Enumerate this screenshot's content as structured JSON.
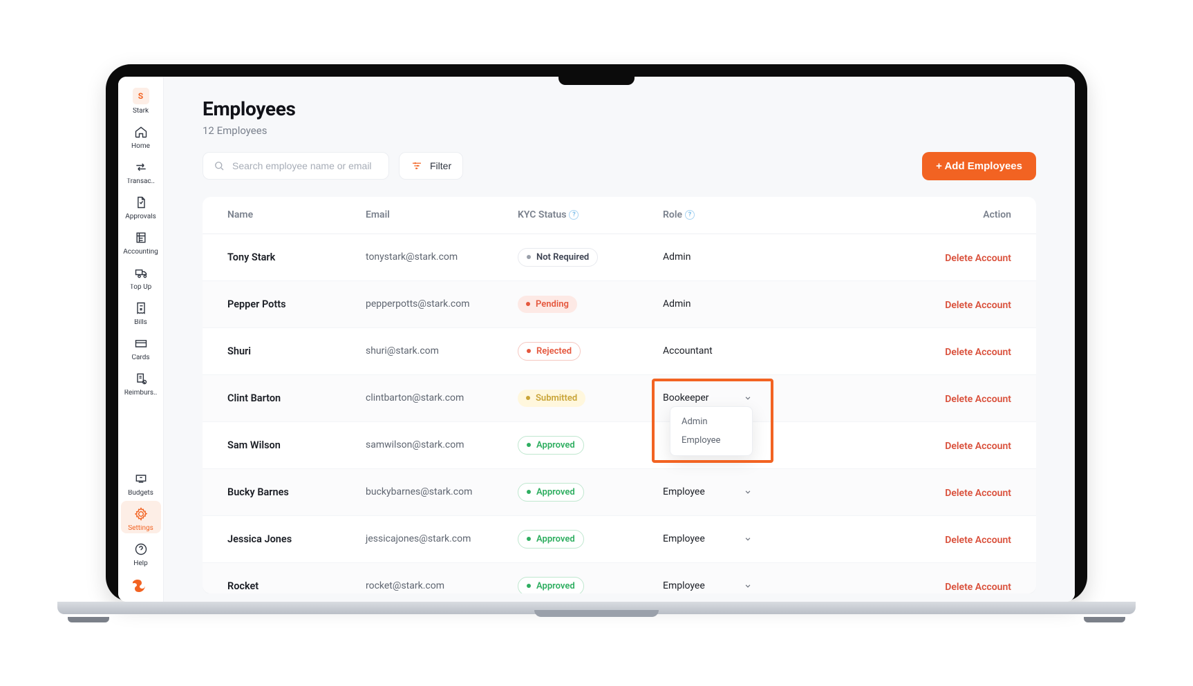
{
  "colors": {
    "accent": "#f26322",
    "danger": "#d94f3a"
  },
  "sidebar": {
    "avatar_letter": "S",
    "avatar_label": "Stark",
    "items_top": [
      {
        "id": "home",
        "label": "Home",
        "icon": "home-icon"
      },
      {
        "id": "transactions",
        "label": "Transac..",
        "icon": "transactions-icon"
      },
      {
        "id": "approvals",
        "label": "Approvals",
        "icon": "approvals-icon"
      },
      {
        "id": "accounting",
        "label": "Accounting",
        "icon": "accounting-icon"
      },
      {
        "id": "topup",
        "label": "Top Up",
        "icon": "topup-icon"
      },
      {
        "id": "bills",
        "label": "Bills",
        "icon": "bills-icon"
      },
      {
        "id": "cards",
        "label": "Cards",
        "icon": "cards-icon"
      },
      {
        "id": "reimburse",
        "label": "Reimburs..",
        "icon": "reimburse-icon"
      }
    ],
    "items_bottom": [
      {
        "id": "budgets",
        "label": "Budgets",
        "icon": "budgets-icon"
      },
      {
        "id": "settings",
        "label": "Settings",
        "icon": "settings-icon",
        "active": true
      },
      {
        "id": "help",
        "label": "Help",
        "icon": "help-icon"
      }
    ]
  },
  "page": {
    "title": "Employees",
    "subtitle_prefix": "12",
    "subtitle_word": "Employees"
  },
  "toolbar": {
    "search_placeholder": "Search employee name or email",
    "filter_label": "Filter",
    "add_label": "+ Add Employees"
  },
  "table": {
    "columns": {
      "name": "Name",
      "email": "Email",
      "kyc": "KYC Status",
      "role": "Role",
      "action": "Action"
    },
    "delete_label": "Delete Account",
    "rows": [
      {
        "name": "Tony Stark",
        "email": "tonystark@stark.com",
        "kyc": "Not Required",
        "kyc_style": "notreq",
        "role": "Admin",
        "role_chev": false
      },
      {
        "name": "Pepper Potts",
        "email": "pepperpotts@stark.com",
        "kyc": "Pending",
        "kyc_style": "pending",
        "role": "Admin",
        "role_chev": false
      },
      {
        "name": "Shuri",
        "email": "shuri@stark.com",
        "kyc": "Rejected",
        "kyc_style": "rejected",
        "role": "Accountant",
        "role_chev": false
      },
      {
        "name": "Clint Barton",
        "email": "clintbarton@stark.com",
        "kyc": "Submitted",
        "kyc_style": "submitted",
        "role": "Bookeeper",
        "role_chev": true,
        "open": true
      },
      {
        "name": "Sam Wilson",
        "email": "samwilson@stark.com",
        "kyc": "Approved",
        "kyc_style": "approved",
        "role": "",
        "role_chev": true
      },
      {
        "name": "Bucky Barnes",
        "email": "buckybarnes@stark.com",
        "kyc": "Approved",
        "kyc_style": "approved",
        "role": "Employee",
        "role_chev": true
      },
      {
        "name": "Jessica Jones",
        "email": "jessicajones@stark.com",
        "kyc": "Approved",
        "kyc_style": "approved",
        "role": "Employee",
        "role_chev": true
      },
      {
        "name": "Rocket",
        "email": "rocket@stark.com",
        "kyc": "Approved",
        "kyc_style": "approved",
        "role": "Employee",
        "role_chev": true
      }
    ]
  },
  "role_dropdown": {
    "options": [
      "Admin",
      "Employee"
    ]
  }
}
